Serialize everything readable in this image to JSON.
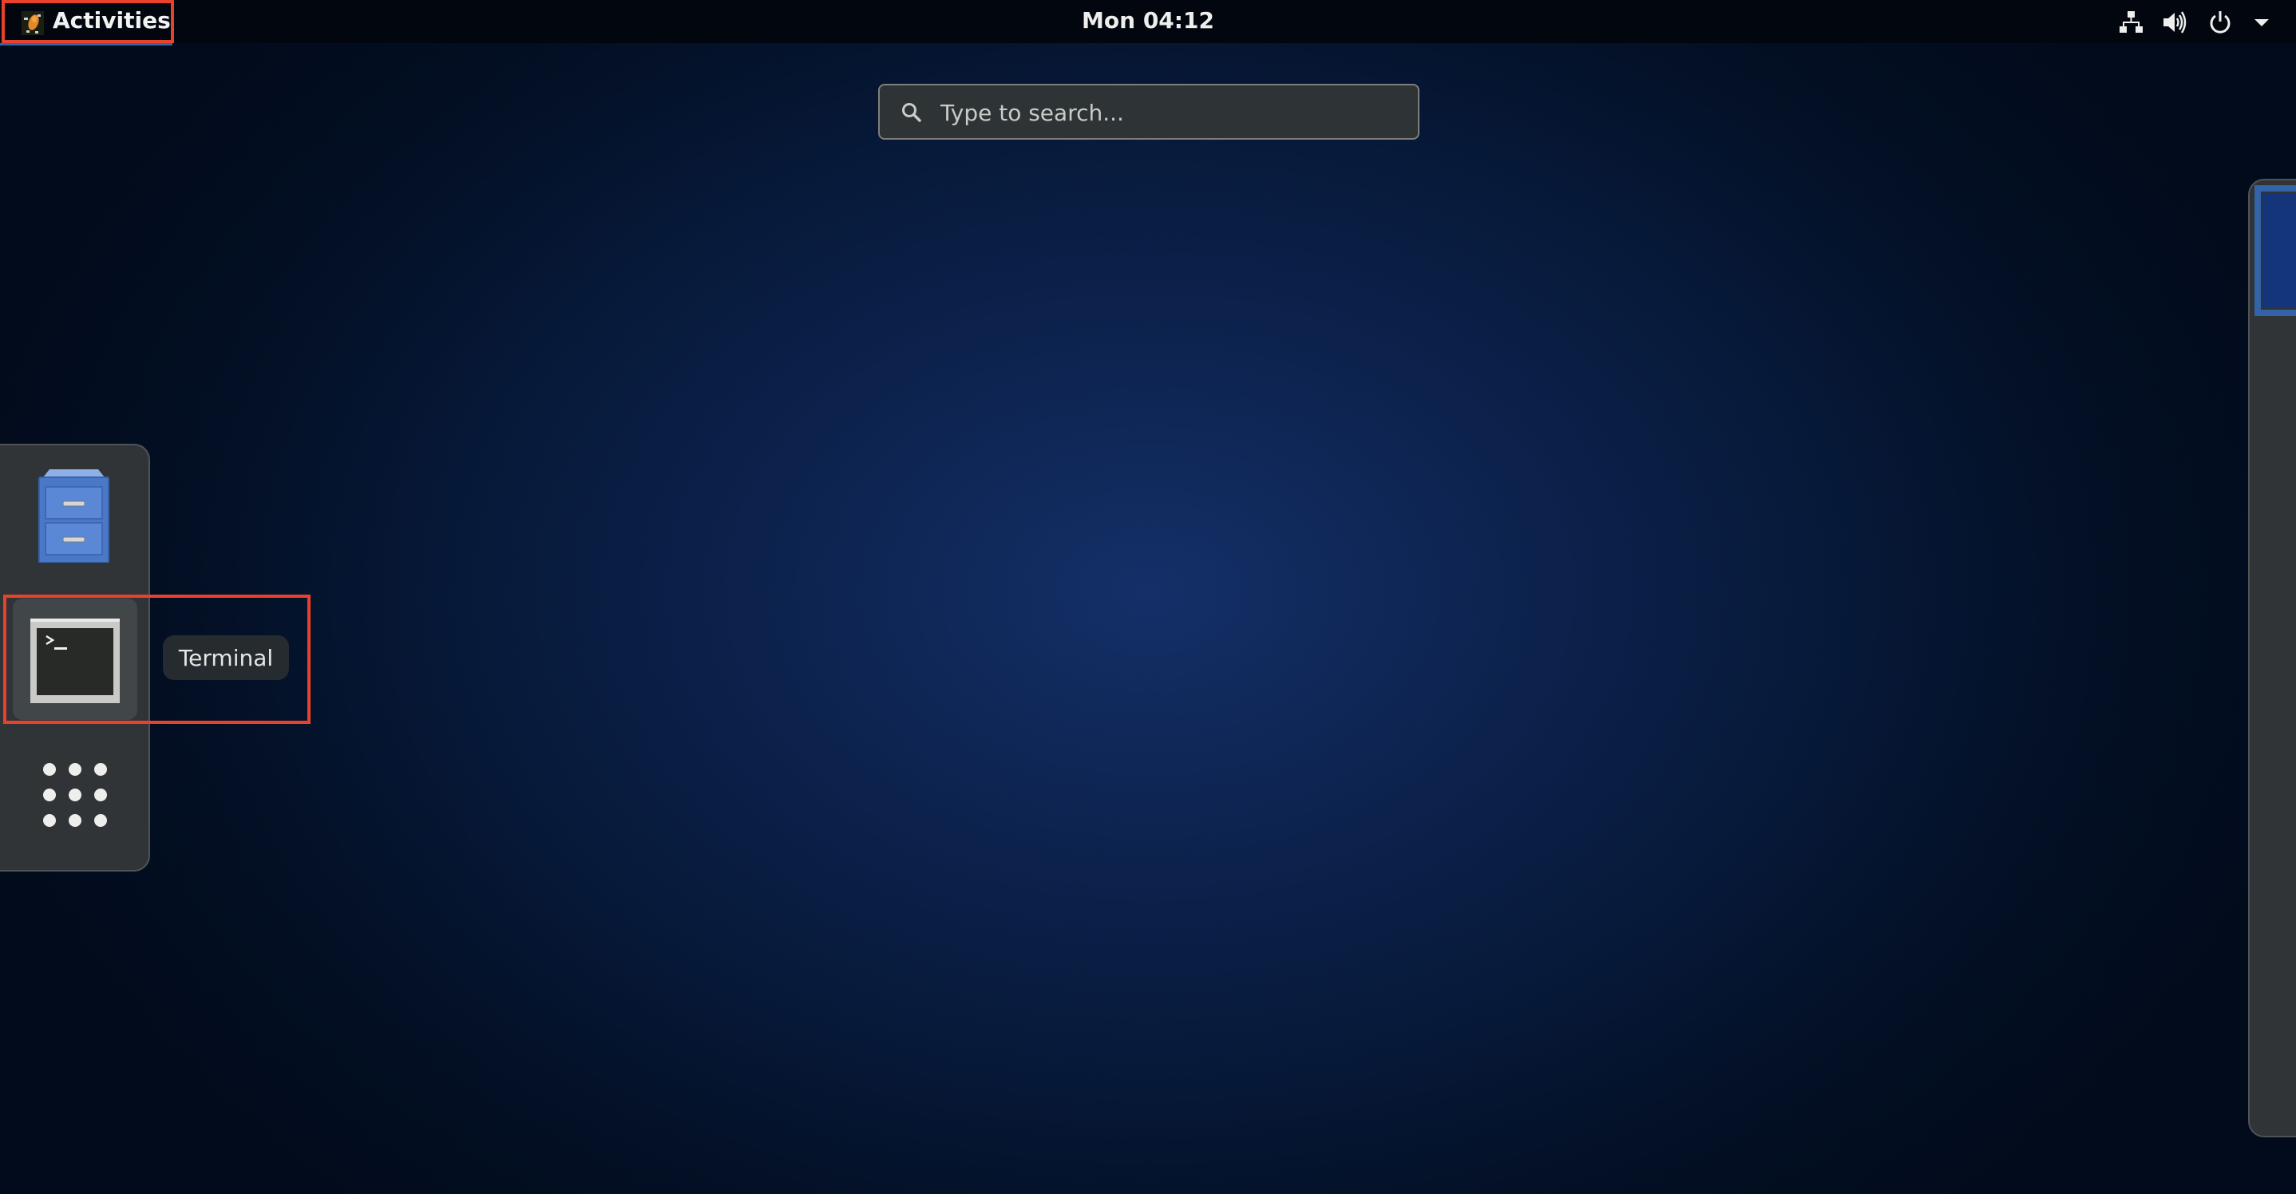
{
  "topbar": {
    "activities_label": "Activities",
    "activities_icon": "distributor-logo-icon",
    "clock": "Mon 04:12",
    "tray_icons": [
      "network-wired-icon",
      "volume-high-icon",
      "power-icon",
      "chevron-down-icon"
    ]
  },
  "search": {
    "placeholder": "Type to search...",
    "value": "",
    "icon": "search-icon"
  },
  "dash": {
    "items": [
      {
        "name": "Files",
        "icon": "file-cabinet-icon",
        "active": false
      },
      {
        "name": "Terminal",
        "icon": "terminal-icon",
        "active": true
      }
    ],
    "tooltip": "Terminal",
    "show_apps_icon": "grid-dots-icon"
  },
  "workspaces": {
    "count_visible": 1,
    "active_index": 0
  },
  "colors": {
    "accent": "#3465a4",
    "annotation": "#e8412c",
    "panel_bg": "#02070f",
    "dash_bg": "#303436",
    "search_bg": "#2e3436"
  }
}
